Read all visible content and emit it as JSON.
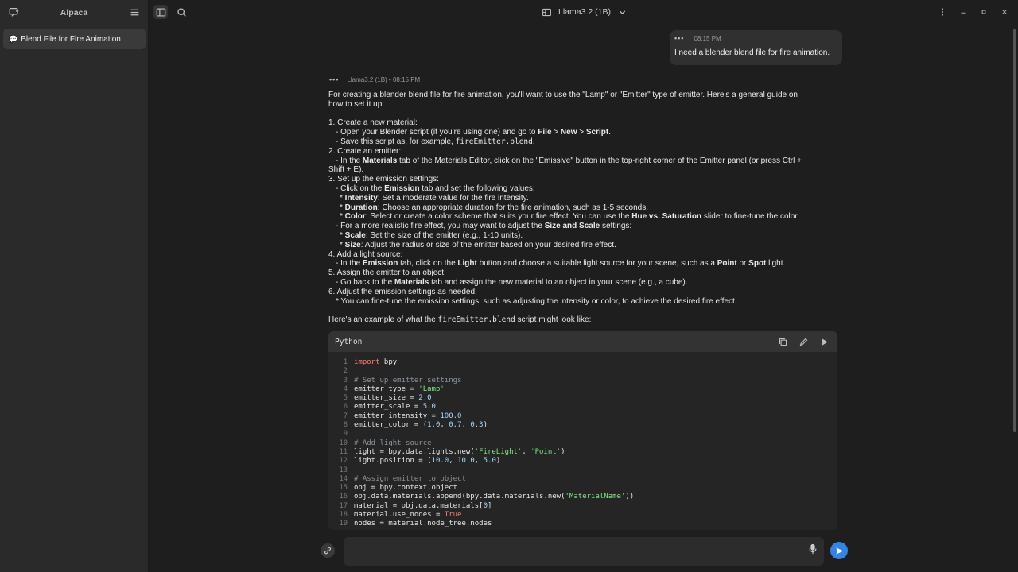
{
  "sidebar": {
    "title": "Alpaca",
    "chats": [
      {
        "label": "Blend File for Fire Animation"
      }
    ]
  },
  "header": {
    "model_name": "Llama3.2 (1B)"
  },
  "user_message": {
    "time": "08:15 PM",
    "text": "I need a blender blend file for fire animation."
  },
  "bot_message": {
    "meta": "Llama3.2 (1B) • 08:15 PM",
    "intro_line1": "For creating a blender blend file for fire animation, you'll want to use the \"Lamp\" or \"Emitter\" type of emitter. Here's a general guide on",
    "intro_line2": "how to set it up:",
    "s1": "1. Create a new material:",
    "s1a_pre": "- Open your Blender script (if you're using one) and go to ",
    "s1a_b1": "File",
    "s1a_sep1": " > ",
    "s1a_b2": "New",
    "s1a_sep2": " > ",
    "s1a_b3": "Script",
    "s1a_end": ".",
    "s1b_pre": "- Save this script as, for example, ",
    "s1b_code": "fireEmitter.blend",
    "s1b_end": ".",
    "s2": "2. Create an emitter:",
    "s2a_pre": "- In the ",
    "s2a_b": "Materials",
    "s2a_post": " tab of the Materials Editor, click on the \"Emissive\" button in the top-right corner of the Emitter panel (or press Ctrl +",
    "s2a_cont": "Shift + E).",
    "s3": "3. Set up the emission settings:",
    "s3a_pre": "- Click on the ",
    "s3a_b": "Emission",
    "s3a_post": " tab and set the following values:",
    "s3b_b": "Intensity",
    "s3b_post": ": Set a moderate value for the fire intensity.",
    "s3c_b": "Duration",
    "s3c_post": ": Choose an appropriate duration for the fire animation, such as 1-5 seconds.",
    "s3d_b": "Color",
    "s3d_mid": ": Select or create a color scheme that suits your fire effect. You can use the ",
    "s3d_b2": "Hue vs. Saturation",
    "s3d_post": " slider to fine-tune the color.",
    "s3e_pre": "- For a more realistic fire effect, you may want to adjust the ",
    "s3e_b": "Size and Scale",
    "s3e_post": " settings:",
    "s3f_b": "Scale",
    "s3f_post": ": Set the size of the emitter (e.g., 1-10 units).",
    "s3g_b": "Size",
    "s3g_post": ": Adjust the radius or size of the emitter based on your desired fire effect.",
    "s4": "4. Add a light source:",
    "s4a_pre": "- In the ",
    "s4a_b": "Emission",
    "s4a_mid": " tab, click on the ",
    "s4a_b2": "Light",
    "s4a_mid2": " button and choose a suitable light source for your scene, such as a ",
    "s4a_b3": "Point",
    "s4a_mid3": " or ",
    "s4a_b4": "Spot",
    "s4a_end": " light.",
    "s5": "5. Assign the emitter to an object:",
    "s5a_pre": "- Go back to the ",
    "s5a_b": "Materials",
    "s5a_post": " tab and assign the new material to an object in your scene (e.g., a cube).",
    "s6": "6. Adjust the emission settings as needed:",
    "s6a": "* You can fine-tune the emission settings, such as adjusting the intensity or color, to achieve the desired fire effect.",
    "example_pre": "Here's an example of what the ",
    "example_code": "fireEmitter.blend",
    "example_post": " script might look like:"
  },
  "code_block": {
    "language": "Python",
    "lines": [
      {
        "n": "1",
        "t": [
          [
            "kw",
            "import"
          ],
          [
            "plain",
            " bpy"
          ]
        ]
      },
      {
        "n": "2",
        "t": []
      },
      {
        "n": "3",
        "t": [
          [
            "com",
            "# Set up emitter settings"
          ]
        ]
      },
      {
        "n": "4",
        "t": [
          [
            "plain",
            "emitter_type = "
          ],
          [
            "str",
            "'Lamp'"
          ]
        ]
      },
      {
        "n": "5",
        "t": [
          [
            "plain",
            "emitter_size = "
          ],
          [
            "num",
            "2.0"
          ]
        ]
      },
      {
        "n": "6",
        "t": [
          [
            "plain",
            "emitter_scale = "
          ],
          [
            "num",
            "5.0"
          ]
        ]
      },
      {
        "n": "7",
        "t": [
          [
            "plain",
            "emitter_intensity = "
          ],
          [
            "num",
            "100.0"
          ]
        ]
      },
      {
        "n": "8",
        "t": [
          [
            "plain",
            "emitter_color = ("
          ],
          [
            "num",
            "1.0"
          ],
          [
            "plain",
            ", "
          ],
          [
            "num",
            "0.7"
          ],
          [
            "plain",
            ", "
          ],
          [
            "num",
            "0.3"
          ],
          [
            "plain",
            ")"
          ]
        ]
      },
      {
        "n": "9",
        "t": []
      },
      {
        "n": "10",
        "t": [
          [
            "com",
            "# Add light source"
          ]
        ]
      },
      {
        "n": "11",
        "t": [
          [
            "plain",
            "light = bpy.data.lights.new("
          ],
          [
            "str",
            "'FireLight'"
          ],
          [
            "plain",
            ", "
          ],
          [
            "str",
            "'Point'"
          ],
          [
            "plain",
            ")"
          ]
        ]
      },
      {
        "n": "12",
        "t": [
          [
            "plain",
            "light.position = ("
          ],
          [
            "num",
            "10.0"
          ],
          [
            "plain",
            ", "
          ],
          [
            "num",
            "10.0"
          ],
          [
            "plain",
            ", "
          ],
          [
            "num",
            "5.0"
          ],
          [
            "plain",
            ")"
          ]
        ]
      },
      {
        "n": "13",
        "t": []
      },
      {
        "n": "14",
        "t": [
          [
            "com",
            "# Assign emitter to object"
          ]
        ]
      },
      {
        "n": "15",
        "t": [
          [
            "plain",
            "obj = bpy.context.object"
          ]
        ]
      },
      {
        "n": "16",
        "t": [
          [
            "plain",
            "obj.data.materials.append(bpy.data.materials.new("
          ],
          [
            "str",
            "'MaterialName'"
          ],
          [
            "plain",
            "))"
          ]
        ]
      },
      {
        "n": "17",
        "t": [
          [
            "plain",
            "material = obj.data.materials["
          ],
          [
            "num",
            "0"
          ],
          [
            "plain",
            "]"
          ]
        ]
      },
      {
        "n": "18",
        "t": [
          [
            "plain",
            "material.use_nodes = "
          ],
          [
            "kw",
            "True"
          ]
        ]
      },
      {
        "n": "19",
        "t": [
          [
            "plain",
            "nodes = material.node_tree.nodes"
          ]
        ]
      }
    ]
  },
  "input": {
    "placeholder": ""
  }
}
